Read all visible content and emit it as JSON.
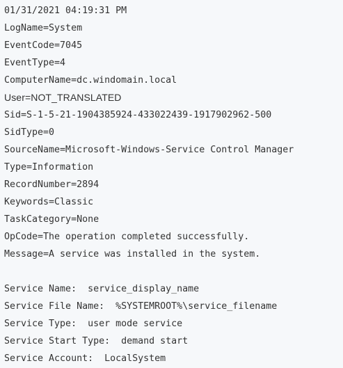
{
  "event": {
    "timestamp": "01/31/2021 04:19:31 PM",
    "fields": [
      "LogName=System",
      "EventCode=7045",
      "EventType=4",
      "ComputerName=dc.windomain.local",
      "User=NOT_TRANSLATED",
      "Sid=S-1-5-21-1904385924-433022439-1917902962-500",
      "SidType=0",
      "SourceName=Microsoft-Windows-Service Control Manager",
      "Type=Information",
      "RecordNumber=2894",
      "Keywords=Classic",
      "TaskCategory=None",
      "OpCode=The operation completed successfully.",
      "Message=A service was installed in the system."
    ],
    "details": [
      "Service Name:  service_display_name",
      "Service File Name:  %SYSTEMROOT%\\service_filename",
      "Service Type:  user mode service",
      "Service Start Type:  demand start",
      "Service Account:  LocalSystem"
    ]
  }
}
